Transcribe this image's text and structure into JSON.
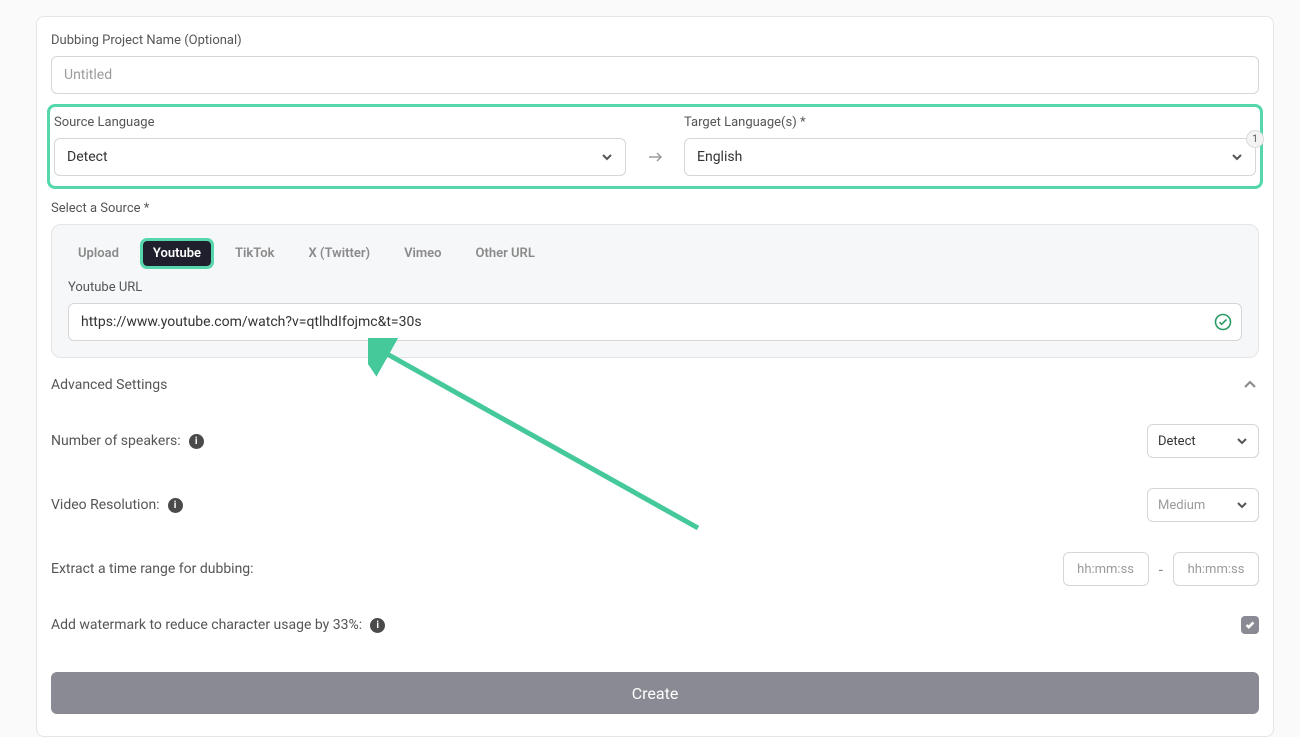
{
  "project": {
    "label": "Dubbing Project Name (Optional)",
    "placeholder": "Untitled"
  },
  "language": {
    "source_label": "Source Language",
    "source_value": "Detect",
    "target_label": "Target Language(s) *",
    "target_value": "English",
    "target_count": "1"
  },
  "source": {
    "label": "Select a Source *",
    "tabs": {
      "upload": "Upload",
      "youtube": "Youtube",
      "tiktok": "TikTok",
      "x": "X (Twitter)",
      "vimeo": "Vimeo",
      "other": "Other URL"
    },
    "url_label": "Youtube URL",
    "url_value": "https://www.youtube.com/watch?v=qtlhdIfojmc&t=30s"
  },
  "advanced": {
    "label": "Advanced Settings",
    "speakers_label": "Number of speakers:",
    "speakers_value": "Detect",
    "resolution_label": "Video Resolution:",
    "resolution_value": "Medium",
    "time_label": "Extract a time range for dubbing:",
    "time_placeholder": "hh:mm:ss",
    "time_sep": "-",
    "watermark_label": "Add watermark to reduce character usage by 33%:"
  },
  "actions": {
    "create": "Create"
  }
}
